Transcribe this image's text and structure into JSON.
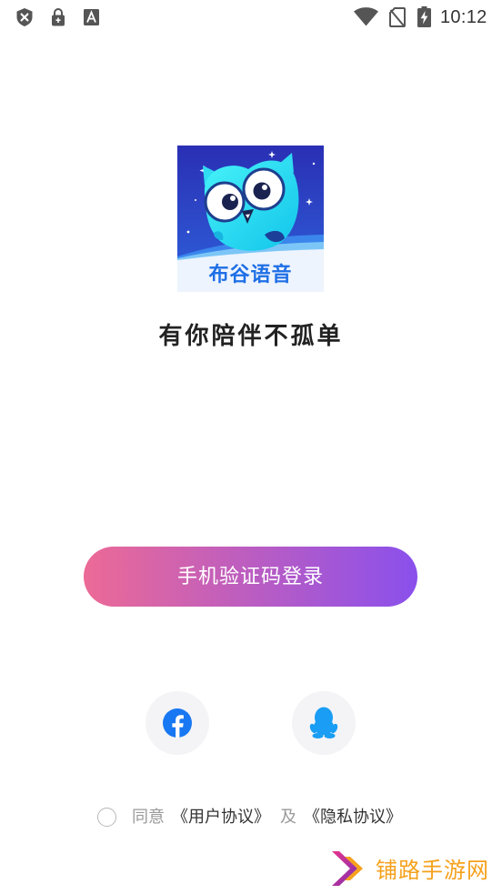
{
  "status_bar": {
    "time": "10:12",
    "icons": {
      "left": [
        "shield-x-icon",
        "lock-icon",
        "font-a-icon"
      ],
      "right": [
        "wifi-icon",
        "no-sim-icon",
        "battery-charging-icon"
      ]
    }
  },
  "logo": {
    "icon": "owl-icon",
    "text": "布谷语音",
    "text_color": "#1e6fe6"
  },
  "slogan": "有你陪伴不孤单",
  "login_button": {
    "label": "手机验证码登录",
    "gradient_start": "#ec6a96",
    "gradient_end": "#8a50ec",
    "text_color": "#ffffff"
  },
  "social_login": [
    {
      "icon": "facebook-icon",
      "color": "#1877f2"
    },
    {
      "icon": "qq-icon",
      "color": "#1a9df4"
    }
  ],
  "agreement": {
    "checked": false,
    "agree_text": "同意",
    "user_agreement": "《用户协议》",
    "and_text": "及",
    "privacy_agreement": "《隐私协议》"
  },
  "watermark": {
    "text": "铺路手游网",
    "color": "#f5a11c"
  }
}
